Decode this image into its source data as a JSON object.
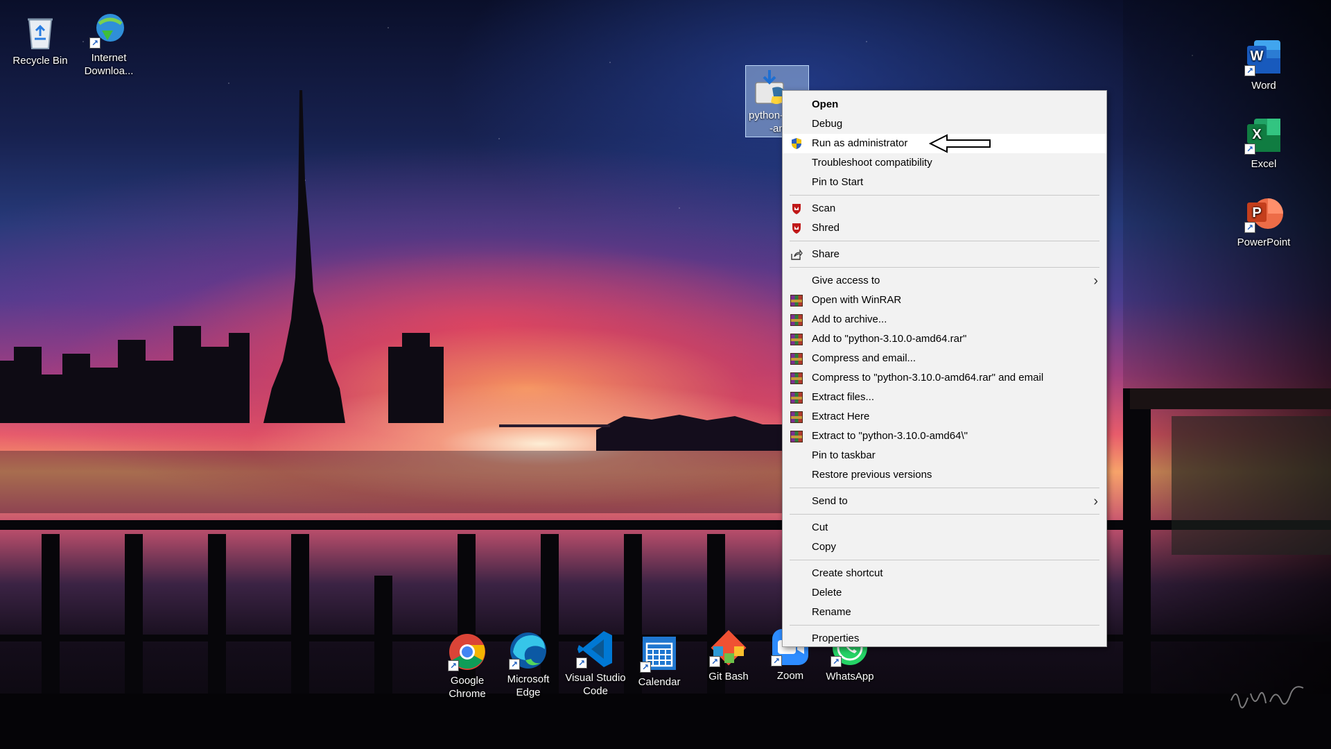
{
  "desktop": {
    "icons_left": [
      {
        "label": "Recycle Bin",
        "icon": "recycle-bin-icon"
      },
      {
        "label": "Internet Downloa...",
        "icon": "internet-download-manager-icon"
      }
    ],
    "icons_right": [
      {
        "label": "Word",
        "icon": "word-icon",
        "color": "#185abd"
      },
      {
        "label": "Excel",
        "icon": "excel-icon",
        "color": "#107c41"
      },
      {
        "label": "PowerPoint",
        "icon": "powerpoint-icon",
        "color": "#c43e1c"
      }
    ],
    "icons_bottom": [
      {
        "label": "Google Chrome",
        "icon": "chrome-icon"
      },
      {
        "label": "Microsoft Edge",
        "icon": "edge-icon"
      },
      {
        "label": "Visual Studio Code",
        "icon": "vscode-icon"
      },
      {
        "label": "Calendar",
        "icon": "calendar-icon"
      },
      {
        "label": "Git Bash",
        "icon": "git-bash-icon"
      },
      {
        "label": "Zoom",
        "icon": "zoom-icon"
      },
      {
        "label": "WhatsApp",
        "icon": "whatsapp-icon"
      }
    ],
    "selected_file": {
      "label_line1": "python-",
      "label_line2": "-amd",
      "icon": "python-installer-icon"
    }
  },
  "context_menu": {
    "items": [
      {
        "label": "Open",
        "bold": true
      },
      {
        "label": "Debug"
      },
      {
        "label": "Run as administrator",
        "icon": "uac-shield-icon",
        "highlighted": true
      },
      {
        "label": "Troubleshoot compatibility"
      },
      {
        "label": "Pin to Start"
      },
      {
        "label": "Scan",
        "icon": "mcafee-icon"
      },
      {
        "label": "Shred",
        "icon": "mcafee-icon"
      },
      {
        "label": "Share",
        "icon": "share-icon"
      },
      {
        "label": "Give access to",
        "submenu": true
      },
      {
        "label": "Open with WinRAR",
        "icon": "winrar-icon"
      },
      {
        "label": "Add to archive...",
        "icon": "winrar-icon"
      },
      {
        "label": "Add to \"python-3.10.0-amd64.rar\"",
        "icon": "winrar-icon"
      },
      {
        "label": "Compress and email...",
        "icon": "winrar-icon"
      },
      {
        "label": "Compress to \"python-3.10.0-amd64.rar\" and email",
        "icon": "winrar-icon"
      },
      {
        "label": "Extract files...",
        "icon": "winrar-icon"
      },
      {
        "label": "Extract Here",
        "icon": "winrar-icon"
      },
      {
        "label": "Extract to \"python-3.10.0-amd64\\\"",
        "icon": "winrar-icon"
      },
      {
        "label": "Pin to taskbar"
      },
      {
        "label": "Restore previous versions"
      },
      {
        "label": "Send to",
        "submenu": true
      },
      {
        "label": "Cut"
      },
      {
        "label": "Copy"
      },
      {
        "label": "Create shortcut"
      },
      {
        "label": "Delete"
      },
      {
        "label": "Rename"
      },
      {
        "label": "Properties"
      }
    ],
    "submenu_glyph": "›"
  },
  "colors": {
    "menu_bg": "#f2f2f2",
    "menu_highlight": "#ffffff",
    "mcafee_red": "#c01818",
    "uac_blue": "#2b5fbf",
    "uac_yellow": "#f2c200"
  }
}
